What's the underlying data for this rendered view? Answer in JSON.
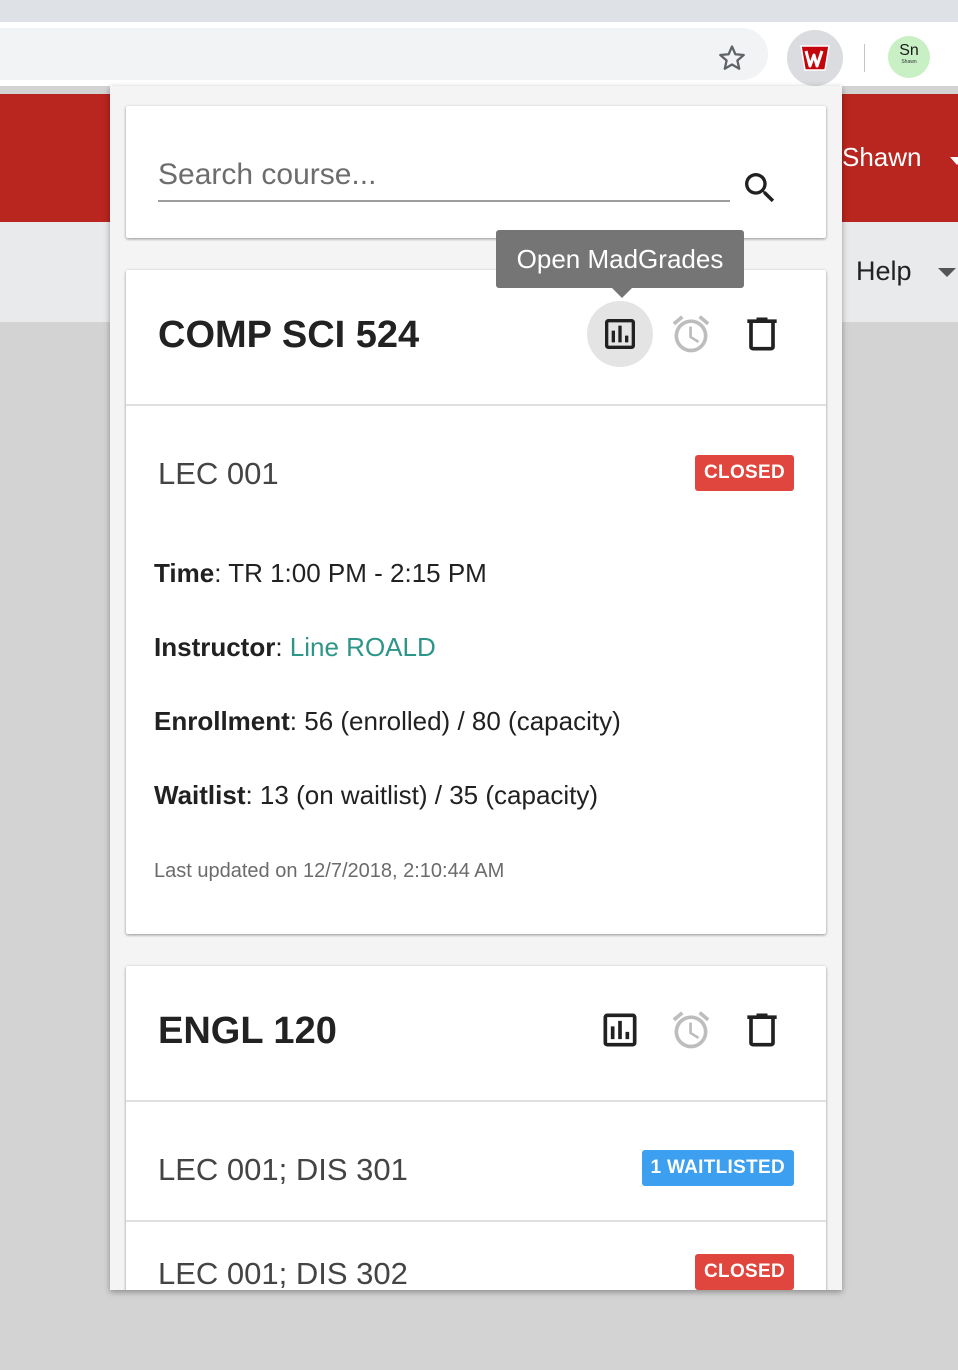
{
  "browser": {
    "avatar_initials": "Sn",
    "avatar_subtext": "Shawn",
    "icons": [
      "star-icon",
      "wisconsin-extension-icon",
      "profile-avatar"
    ]
  },
  "page": {
    "user_name": "Shawn",
    "help_label": "Help"
  },
  "popup": {
    "search_placeholder": "Search course...",
    "tooltip": "Open MadGrades",
    "courses": [
      {
        "title": "COMP SCI 524",
        "sections": [
          {
            "name": "LEC 001",
            "status": "CLOSED",
            "time_label": "Time",
            "time_value": ": TR 1:00 PM - 2:15 PM",
            "instructor_label": "Instructor",
            "instructor_sep": ": ",
            "instructor_value": "Line ROALD",
            "enrollment_label": "Enrollment",
            "enrollment_value": ": 56 (enrolled) / 80 (capacity)",
            "waitlist_label": "Waitlist",
            "waitlist_value": ": 13 (on waitlist) / 35 (capacity)",
            "last_updated": "Last updated on 12/7/2018, 2:10:44 AM"
          }
        ]
      },
      {
        "title": "ENGL 120",
        "sections": [
          {
            "name": "LEC 001; DIS 301",
            "status": "1 WAITLISTED"
          },
          {
            "name": "LEC 001; DIS 302",
            "status": "CLOSED"
          }
        ]
      }
    ]
  },
  "colors": {
    "brand_red": "#b9251f",
    "closed_badge": "#e0463d",
    "waitlisted_badge": "#3d9ff0",
    "instructor_link": "#2e9688"
  }
}
